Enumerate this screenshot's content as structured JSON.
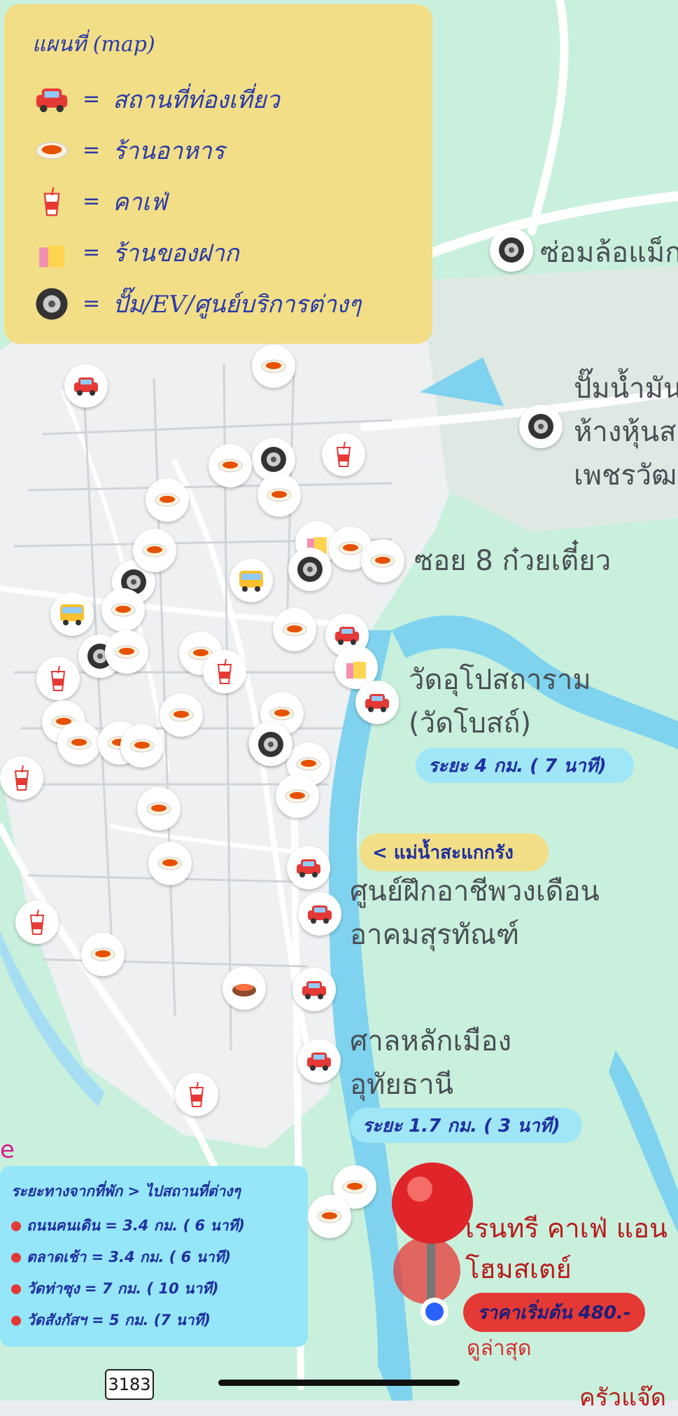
{
  "legend": {
    "title": "แผนที่ (map)",
    "items": [
      {
        "icon": "car-icon",
        "label": "สถานที่ท่องเที่ยว"
      },
      {
        "icon": "noodle-bowl-icon",
        "label": "ร้านอาหาร"
      },
      {
        "icon": "drink-cup-icon",
        "label": "คาเฟ่"
      },
      {
        "icon": "shopping-bag-icon",
        "label": "ร้านของฝาก"
      },
      {
        "icon": "tire-icon",
        "label": "ปั๊ม/EV/ศูนย์บริการต่างๆ"
      }
    ],
    "equals": "="
  },
  "places": {
    "wheel_shop": "ซ่อมล้อแม็ก",
    "gas_station": [
      "ปั๊มน้ำมัน",
      "ห้างหุ้นส",
      "เพชรวัฒ"
    ],
    "soi8": "ซอย 8 ก๋วยเตี๋ยว",
    "temple": [
      "วัดอุโปสถาราม",
      "(วัดโบสถ์)"
    ],
    "training_center": [
      "ศูนย์ฝึกอาชีพวงเดือน",
      "อาคมสุรทัณฑ์"
    ],
    "city_pillar": [
      "ศาลหลักเมือง",
      "อุทัยธานี"
    ]
  },
  "badges": {
    "temple_distance": "ระยะ 4 กม. ( 7 นาที)",
    "pillar_distance": "ระยะ 1.7 กม. ( 3 นาที)",
    "river": "< แม่น้ำสะแกกรัง"
  },
  "distances": {
    "title": "ระยะทางจากที่พัก > ไปสถานที่ต่างๆ",
    "items": [
      "ถนนคนเดิน = 3.4 กม. ( 6 นาที)",
      "ตลาดเช้า = 3.4 กม. ( 6 นาที)",
      "วัดท่าซุง = 7 กม. ( 10 นาที)",
      "วัดสังกัสฯ = 5 กม. (7 นาที)"
    ]
  },
  "hotel": {
    "name": [
      "เรนทรี คาเฟ่ แอน",
      "โฮมสเตย์"
    ],
    "price": "ราคาเริ่มต้น 480.-",
    "latest": "ดูล่าสุด"
  },
  "road_number": "3183",
  "edge_text": "e",
  "edge_bottom_text": "ครัวแจ๊ด",
  "colors": {
    "legend_bg": "#f1de86",
    "badge_bg": "#9fe6f7",
    "river": "#7fd3ef",
    "park": "#c9f0dc",
    "price_bg": "#e53935"
  }
}
